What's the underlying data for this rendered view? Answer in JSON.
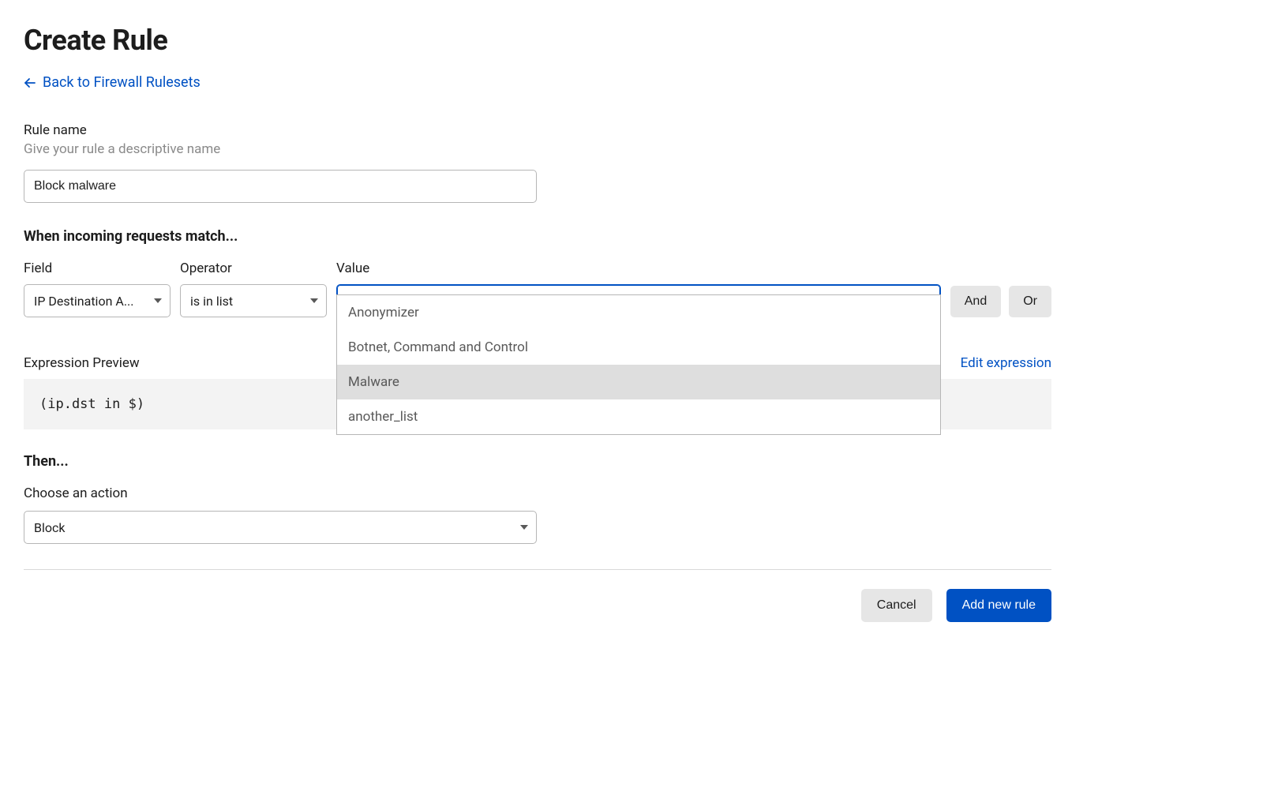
{
  "page": {
    "title": "Create Rule",
    "back_link": "Back to Firewall Rulesets"
  },
  "rule_name": {
    "label": "Rule name",
    "help": "Give your rule a descriptive name",
    "value": "Block malware"
  },
  "match": {
    "header": "When incoming requests match...",
    "columns": {
      "field": "Field",
      "operator": "Operator",
      "value": "Value"
    },
    "field_value": "IP Destination A...",
    "operator_value": "is in list",
    "value_value": "",
    "value_options": [
      {
        "label": "Anonymizer",
        "highlighted": false
      },
      {
        "label": "Botnet, Command and Control",
        "highlighted": false
      },
      {
        "label": "Malware",
        "highlighted": true
      },
      {
        "label": "another_list",
        "highlighted": false
      }
    ],
    "and_label": "And",
    "or_label": "Or"
  },
  "expression": {
    "label": "Expression Preview",
    "edit_link": "Edit expression",
    "code": "(ip.dst in $)"
  },
  "then": {
    "header": "Then...",
    "action_label": "Choose an action",
    "action_value": "Block"
  },
  "footer": {
    "cancel": "Cancel",
    "submit": "Add new rule"
  }
}
